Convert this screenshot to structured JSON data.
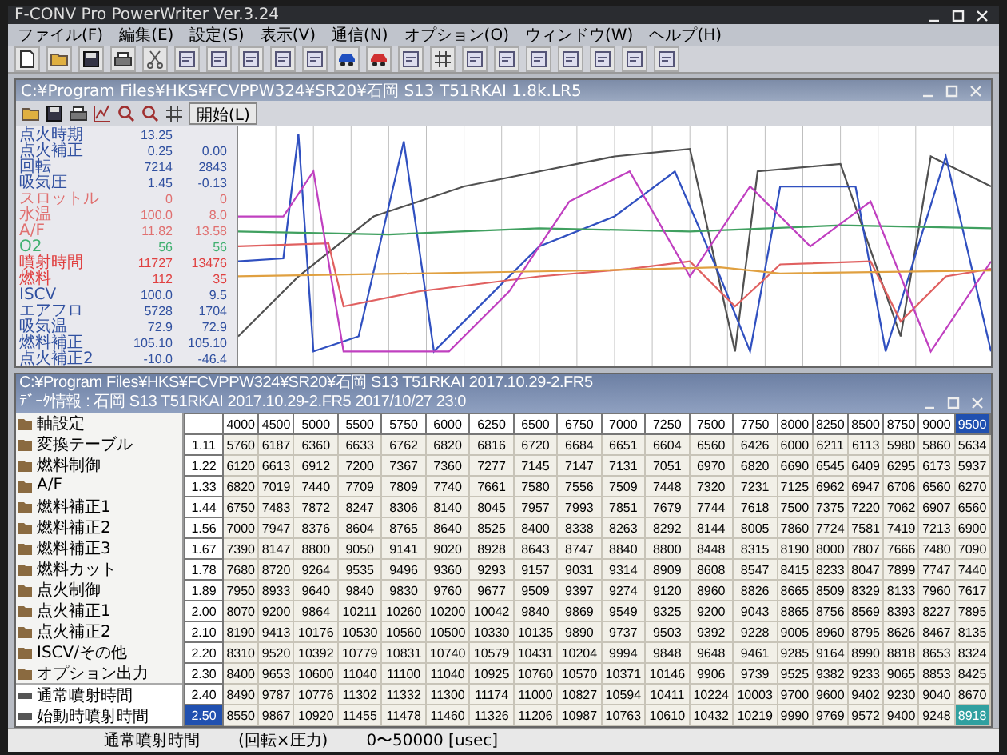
{
  "window": {
    "title": "F-CONV Pro PowerWriter Ver.3.24"
  },
  "menu": [
    "ファイル(F)",
    "編集(E)",
    "設定(S)",
    "表示(V)",
    "通信(N)",
    "オプション(O)",
    "ウィンドウ(W)",
    "ヘルプ(H)"
  ],
  "log_window": {
    "title": "C:¥Program Files¥HKS¥FCVPPW324¥SR20¥石岡 S13 T51RKAI 1.8k.LR5",
    "start_button": "開始(L)",
    "readings": [
      {
        "label": "点火時期",
        "value_1": "13.25",
        "color": "#3050a0"
      },
      {
        "label": "点火補正",
        "value_1": "0.25",
        "value_2": "0.00",
        "color": "#3050a0"
      },
      {
        "label": "回転",
        "value_1": "7214",
        "value_2": "2843",
        "color": "#3050a0"
      },
      {
        "label": "吸気圧",
        "value_1": "1.45",
        "value_2": "-0.13",
        "color": "#3050a0"
      },
      {
        "label": "スロットル",
        "value_1": "0",
        "value_2": "0",
        "color": "#e07070"
      },
      {
        "label": "水温",
        "value_1": "100.0",
        "value_2": "8.0",
        "color": "#e07070"
      },
      {
        "label": "A/F",
        "value_1": "11.82",
        "value_2": "13.58",
        "color": "#e07070"
      },
      {
        "label": "O2",
        "value_1": "56",
        "value_2": "56",
        "color": "#40b070"
      },
      {
        "label": "噴射時間",
        "value_1": "11727",
        "value_2": "13476",
        "color": "#e04040"
      },
      {
        "label": "燃料",
        "value_1": "112",
        "value_2": "35",
        "color": "#e04040"
      },
      {
        "label": "ISCV",
        "value_1": "100.0",
        "value_2": "9.5",
        "color": "#3050a0"
      },
      {
        "label": "エアフロ",
        "value_1": "5728",
        "value_2": "1704",
        "color": "#3050a0"
      },
      {
        "label": "吸気温",
        "value_1": "72.9",
        "value_2": "72.9",
        "color": "#3050a0"
      },
      {
        "label": "燃料補正",
        "value_1": "105.10",
        "value_2": "105.10",
        "color": "#3050a0"
      },
      {
        "label": "点火補正2",
        "value_1": "-10.0",
        "value_2": "-46.4",
        "color": "#3050a0"
      }
    ]
  },
  "map_window": {
    "title": "C:¥Program Files¥HKS¥FCVPPW324¥SR20¥石岡 S13 T51RKAI 2017.10.29-2.FR5",
    "info": "ﾃﾞｰﾀ情報 : 石岡 S13 T51RKAI 2017.10.29-2.FR5  2017/10/27 23:0",
    "tree": [
      "軸設定",
      "変換テーブル",
      "燃料制御",
      "A/F",
      "燃料補正1",
      "燃料補正2",
      "燃料補正3",
      "燃料カット",
      "点火制御",
      "点火補正1",
      "点火補正2",
      "ISCV/その他",
      "オプション出力"
    ],
    "maps": [
      "通常噴射時間",
      "始動時噴射時間"
    ]
  },
  "table": {
    "columns": [
      {
        "label": "4000",
        "selected": false
      },
      {
        "label": "4500",
        "selected": false
      },
      {
        "label": "5000",
        "selected": false
      },
      {
        "label": "5500",
        "selected": false
      },
      {
        "label": "5750",
        "selected": false
      },
      {
        "label": "6000",
        "selected": false
      },
      {
        "label": "6250",
        "selected": false
      },
      {
        "label": "6500",
        "selected": false
      },
      {
        "label": "6750",
        "selected": false
      },
      {
        "label": "7000",
        "selected": false
      },
      {
        "label": "7250",
        "selected": false
      },
      {
        "label": "7500",
        "selected": false
      },
      {
        "label": "7750",
        "selected": false
      },
      {
        "label": "8000",
        "selected": false
      },
      {
        "label": "8250",
        "selected": false
      },
      {
        "label": "8500",
        "selected": false
      },
      {
        "label": "8750",
        "selected": false
      },
      {
        "label": "9000",
        "selected": false
      },
      {
        "label": "9500",
        "selected": true
      }
    ],
    "rows": [
      {
        "label": "1.11",
        "selected": false,
        "cells": [
          "5760",
          "6187",
          "6360",
          "6633",
          "6762",
          "6820",
          "6816",
          "6720",
          "6684",
          "6651",
          "6604",
          "6560",
          "6426",
          "6000",
          "6211",
          "6113",
          "5980",
          "5860",
          "5634"
        ]
      },
      {
        "label": "1.22",
        "selected": false,
        "cells": [
          "6120",
          "6613",
          "6912",
          "7200",
          "7367",
          "7360",
          "7277",
          "7145",
          "7147",
          "7131",
          "7051",
          "6970",
          "6820",
          "6690",
          "6545",
          "6409",
          "6295",
          "6173",
          "5937"
        ]
      },
      {
        "label": "1.33",
        "selected": false,
        "cells": [
          "6820",
          "7019",
          "7440",
          "7709",
          "7809",
          "7740",
          "7661",
          "7580",
          "7556",
          "7509",
          "7448",
          "7320",
          "7231",
          "7125",
          "6962",
          "6947",
          "6706",
          "6560",
          "6270"
        ]
      },
      {
        "label": "1.44",
        "selected": false,
        "cells": [
          "6750",
          "7483",
          "7872",
          "8247",
          "8306",
          "8140",
          "8045",
          "7957",
          "7993",
          "7851",
          "7679",
          "7744",
          "7618",
          "7500",
          "7375",
          "7220",
          "7062",
          "6907",
          "6560"
        ]
      },
      {
        "label": "1.56",
        "selected": false,
        "cells": [
          "7000",
          "7947",
          "8376",
          "8604",
          "8765",
          "8640",
          "8525",
          "8400",
          "8338",
          "8263",
          "8292",
          "8144",
          "8005",
          "7860",
          "7724",
          "7581",
          "7419",
          "7213",
          "6900"
        ]
      },
      {
        "label": "1.67",
        "selected": false,
        "cells": [
          "7390",
          "8147",
          "8800",
          "9050",
          "9141",
          "9020",
          "8928",
          "8643",
          "8747",
          "8840",
          "8800",
          "8448",
          "8315",
          "8190",
          "8000",
          "7807",
          "7666",
          "7480",
          "7090"
        ]
      },
      {
        "label": "1.78",
        "selected": false,
        "cells": [
          "7680",
          "8720",
          "9264",
          "9535",
          "9496",
          "9360",
          "9293",
          "9157",
          "9031",
          "9314",
          "8909",
          "8608",
          "8547",
          "8415",
          "8233",
          "8047",
          "7899",
          "7747",
          "7440"
        ]
      },
      {
        "label": "1.89",
        "selected": false,
        "cells": [
          "7950",
          "8933",
          "9640",
          "9840",
          "9830",
          "9760",
          "9677",
          "9509",
          "9397",
          "9274",
          "9120",
          "8960",
          "8826",
          "8665",
          "8509",
          "8329",
          "8133",
          "7960",
          "7617"
        ]
      },
      {
        "label": "2.00",
        "selected": false,
        "cells": [
          "8070",
          "9200",
          "9864",
          "10211",
          "10260",
          "10200",
          "10042",
          "9840",
          "9869",
          "9549",
          "9325",
          "9200",
          "9043",
          "8865",
          "8756",
          "8569",
          "8393",
          "8227",
          "7895"
        ]
      },
      {
        "label": "2.10",
        "selected": false,
        "cells": [
          "8190",
          "9413",
          "10176",
          "10530",
          "10560",
          "10500",
          "10330",
          "10135",
          "9890",
          "9737",
          "9503",
          "9392",
          "9228",
          "9005",
          "8960",
          "8795",
          "8626",
          "8467",
          "8135"
        ]
      },
      {
        "label": "2.20",
        "selected": false,
        "cells": [
          "8310",
          "9520",
          "10392",
          "10779",
          "10831",
          "10740",
          "10579",
          "10431",
          "10204",
          "9994",
          "9848",
          "9648",
          "9461",
          "9285",
          "9164",
          "8990",
          "8818",
          "8653",
          "8324"
        ]
      },
      {
        "label": "2.30",
        "selected": false,
        "cells": [
          "8400",
          "9653",
          "10600",
          "11040",
          "11100",
          "11040",
          "10925",
          "10760",
          "10570",
          "10371",
          "10146",
          "9906",
          "9739",
          "9525",
          "9382",
          "9233",
          "9065",
          "8853",
          "8425"
        ]
      },
      {
        "label": "2.40",
        "selected": false,
        "cells": [
          "8490",
          "9787",
          "10776",
          "11302",
          "11332",
          "11300",
          "11174",
          "11000",
          "10827",
          "10594",
          "10411",
          "10224",
          "10003",
          "9700",
          "9600",
          "9402",
          "9230",
          "9040",
          "8670"
        ]
      },
      {
        "label": "2.50",
        "selected": true,
        "cells": [
          "8550",
          "9867",
          "10920",
          "11455",
          "11478",
          "11460",
          "11326",
          "11206",
          "10987",
          "10763",
          "10610",
          "10432",
          "10219",
          "9990",
          "9769",
          "9572",
          "9400",
          "9248",
          "8918"
        ]
      }
    ]
  },
  "status_bar": [
    "通常噴射時間",
    "(回転×圧力)",
    "0〜50000 [usec]"
  ]
}
